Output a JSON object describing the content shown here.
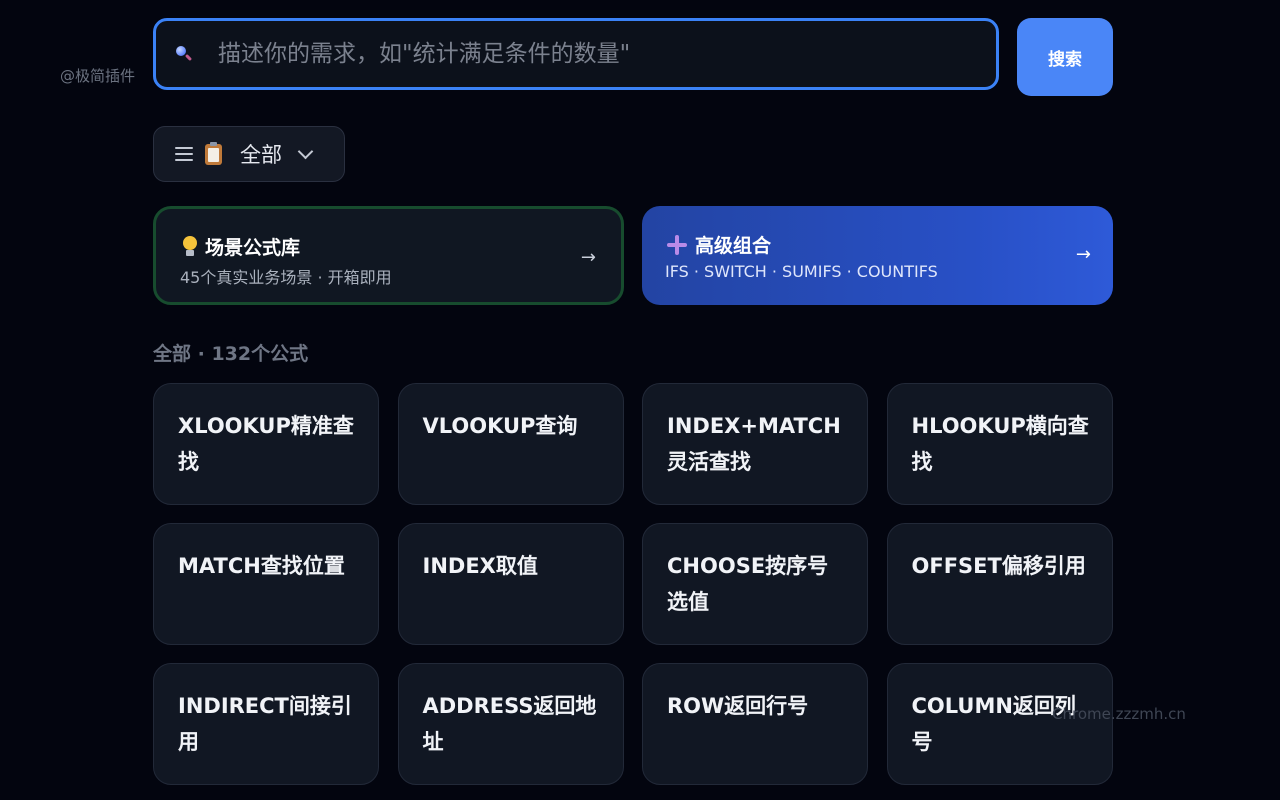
{
  "watermarks": {
    "left": "@极简插件",
    "right": "Chrome.zzzmh.cn"
  },
  "search": {
    "placeholder": "描述你的需求，如\"统计满足条件的数量\"",
    "value": "",
    "button_label": "搜索"
  },
  "filter": {
    "label": "全部"
  },
  "cards": {
    "scene": {
      "title": "场景公式库",
      "subtitle": "45个真实业务场景 · 开箱即用",
      "arrow": "→"
    },
    "advanced": {
      "title": "高级组合",
      "subtitle": "IFS · SWITCH · SUMIFS · COUNTIFS",
      "arrow": "→"
    }
  },
  "section": {
    "label": "全部 · 132个公式"
  },
  "formulas": [
    "XLOOKUP精准查找",
    "VLOOKUP查询",
    "INDEX+MATCH灵活查找",
    "HLOOKUP横向查找",
    "MATCH查找位置",
    "INDEX取值",
    "CHOOSE按序号选值",
    "OFFSET偏移引用",
    "INDIRECT间接引用",
    "ADDRESS返回地址",
    "ROW返回行号",
    "COLUMN返回列号"
  ],
  "colors": {
    "background": "#03050f",
    "accent": "#3b82f6",
    "button": "#4a86f7",
    "scene_border": "#174c2e",
    "advanced_gradient": "#2850c6"
  },
  "icons": [
    "search-icon",
    "menu-icon",
    "clipboard-icon",
    "chevron-down-icon",
    "lightbulb-icon",
    "plus-icon",
    "arrow-right-icon"
  ]
}
